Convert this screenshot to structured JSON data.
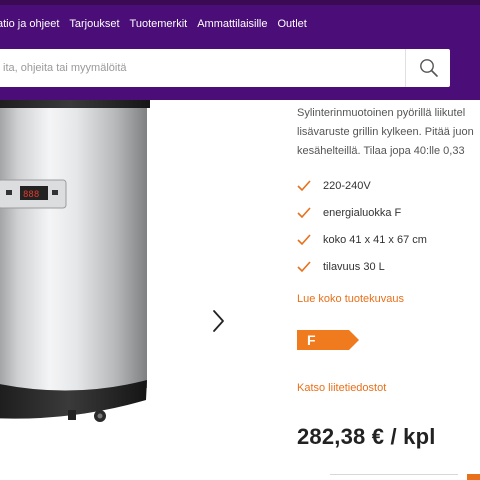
{
  "nav": {
    "links": [
      "atio ja ohjeet",
      "Tarjoukset",
      "Tuotemerkit",
      "Ammattilaisille",
      "Outlet"
    ]
  },
  "search": {
    "placeholder": "ita, ohjeita tai myymälöitä",
    "icon": "search-icon"
  },
  "colors": {
    "nav_bg": "#4b0e78",
    "accent": "#e8701a",
    "energy_badge": "#f07a1e"
  },
  "product": {
    "description_lines": [
      "Sylinterinmuotoinen pyörillä liikutel",
      "lisävaruste grillin kylkeen. Pitää juon",
      "kesähelteillä. Tilaa jopa 40:lle 0,33"
    ],
    "features": [
      "220-240V",
      "energialuokka F",
      "koko 41 x 41 x 67 cm",
      "tilavuus 30 L"
    ],
    "read_more": "Lue koko tuotekuvaus",
    "energy_class": "F",
    "attachments": "Katso liitetiedostot",
    "price": "282,38 € / kpl"
  }
}
